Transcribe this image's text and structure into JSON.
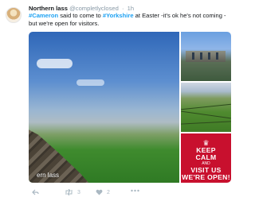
{
  "author": {
    "name": "Northern lass",
    "handle": "@completlyclosed",
    "time": "1h"
  },
  "tweet": {
    "hashtag1": "#Cameron",
    "text1": " said to come to ",
    "hashtag2": "#Yorkshire",
    "text2": " at Easter -it's ok he's not coming - but we're open for visitors."
  },
  "media": {
    "watermark": "ern lass",
    "poster": {
      "line1": "KEEP",
      "line2": "CALM",
      "line3": "AND",
      "line4": "VISIT US",
      "line5": "WE'RE OPEN!"
    }
  },
  "actions": {
    "retweet_count": "3",
    "like_count": "2"
  },
  "colors": {
    "link": "#1da1f2",
    "poster_red": "#c8102e",
    "meta_grey": "#8899a6"
  }
}
